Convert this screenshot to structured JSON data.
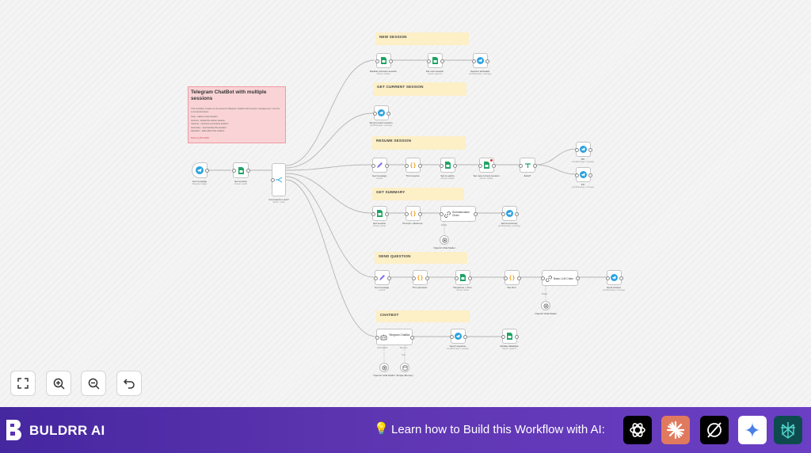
{
  "note": {
    "title": "Telegram ChatBot with multiple sessions",
    "body": "This workflow creates an AI-powered Telegram chatbot with session management. Use the commands below:",
    "commands": [
      "/new - starts a new session",
      "/current - shows the active session",
      "/resume - resumes a previous session",
      "/summary - summarizes the session",
      "/question - asks about the session"
    ],
    "footer": "Made by BULDRR"
  },
  "sections": {
    "new_session": "NEW SESSION",
    "get_current": "GET CURRENT SESSION",
    "resume": "RESUME SESSION",
    "summary": "GET SUMMARY",
    "send_question": "SEND QUESTION",
    "chatbot": "CHATBOT"
  },
  "nodes": {
    "trigger": {
      "label": "Get message",
      "sub": "Telegram trigger"
    },
    "get_session": {
      "label": "Get session",
      "sub": "sheets: getAll"
    },
    "command": {
      "label": "Command or text?",
      "sub": "Switch: mode"
    },
    "disable": {
      "label": "Disable previous session",
      "sub": "sheets: update"
    },
    "set_new": {
      "label": "Set new session",
      "sub": "sheets: append"
    },
    "session_activated": {
      "label": "Session activated",
      "sub": "sendMessage: message"
    },
    "send_current": {
      "label": "Send current session",
      "sub": "sendMessage: message"
    },
    "get_message": {
      "label": "Get message",
      "sub": "manual"
    },
    "trim": {
      "label": "Trim resume",
      "sub": ""
    },
    "set_active": {
      "label": "Set to expire",
      "sub": "sheets: update"
    },
    "set_current": {
      "label": "Set new current session",
      "sub": "sheets: update"
    },
    "exist": {
      "label": "Exist?",
      "sub": ""
    },
    "ok": {
      "label": "OK",
      "sub": "sendMessage: message"
    },
    "ko": {
      "label": "KO",
      "sub": "sendMessage: message"
    },
    "get_session2": {
      "label": "Get session",
      "sub": "sheets: getAll"
    },
    "prompt": {
      "label": "Prompt + Resume",
      "sub": ""
    },
    "summarization": {
      "label": "Summarization Chain",
      "sub": ""
    },
    "send_summary": {
      "label": "Send summary",
      "sub": "sendMessage: message"
    },
    "openai_chat1": {
      "label": "OpenAI Chat Model",
      "sub": ""
    },
    "get_message2": {
      "label": "Get message",
      "sub": "manual"
    },
    "trim_question": {
      "label": "Trim question",
      "sub": ""
    },
    "response": {
      "label": "Response + Text",
      "sub": "sheets: getAll"
    },
    "set_text": {
      "label": "Set Text",
      "sub": ""
    },
    "basic_chain": {
      "label": "Basic LLM Chain",
      "sub": ""
    },
    "send_answer": {
      "label": "Send answer",
      "sub": "sendMessage: message"
    },
    "openai_chat2": {
      "label": "OpenAI Chat Model",
      "sub": ""
    },
    "telegram_chatbot": {
      "label": "Telegram ChatBot",
      "sub": ""
    },
    "send_response": {
      "label": "Send response",
      "sub": "sendMessage: message"
    },
    "update_database": {
      "label": "Update database",
      "sub": "sheets: append"
    },
    "openai_chat3": {
      "label": "OpenAI Chat Model",
      "sub": ""
    },
    "simple_memory": {
      "label": "Simple Memory",
      "sub": ""
    }
  },
  "ports": {
    "model": "Model",
    "chat_model": "Chat Model",
    "memory": "Memory",
    "tool": "Tool"
  },
  "toolbar": {
    "fit": "fit-view-icon",
    "zoom_in": "zoom-in-icon",
    "zoom_out": "zoom-out-icon",
    "undo": "undo-icon"
  },
  "footer": {
    "brand": "BULDRR AI",
    "cta_icon": "💡",
    "cta": "Learn how to Build this Workflow with AI:",
    "ai_tools": [
      "chatgpt-icon",
      "claude-icon",
      "grok-icon",
      "gemini-icon",
      "perplexity-icon"
    ]
  },
  "colors": {
    "telegram": "#2aa3e0",
    "sheets": "#1fa463",
    "code": "#f0a020",
    "sticky": "#fdefc6",
    "note": "#f9d3d5",
    "footer_start": "#4527a0",
    "footer_end": "#6a3fc4"
  }
}
